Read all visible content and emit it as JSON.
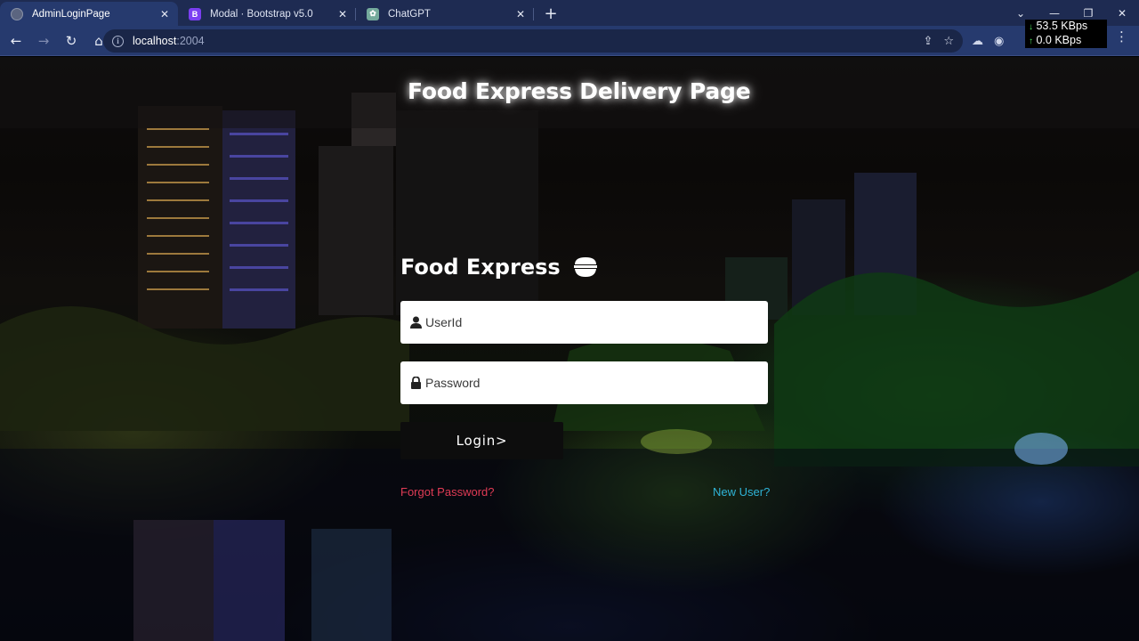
{
  "browser": {
    "tabs": [
      {
        "label": "AdminLoginPage",
        "active": true,
        "icon": "globe-icon"
      },
      {
        "label": "Modal · Bootstrap v5.0",
        "active": false,
        "icon": "bootstrap-icon"
      },
      {
        "label": "ChatGPT",
        "active": false,
        "icon": "chatgpt-icon"
      }
    ],
    "url_host": "localhost",
    "url_port": ":2004",
    "net_up": "53.5 KBps",
    "net_down": "0.0 KBps"
  },
  "page": {
    "title": "Food Express Delivery Page",
    "brand": "Food Express",
    "userid_placeholder": "UserId",
    "password_placeholder": "Password",
    "login_label": "Login>",
    "forgot_label": "Forgot Password?",
    "newuser_label": "New User?"
  },
  "colors": {
    "tabbar": "#1e2b52",
    "toolbar": "#263a6e",
    "forgot_link": "#e03b55",
    "newuser_link": "#2fb3d6",
    "login_button": "#0d0d0d"
  }
}
